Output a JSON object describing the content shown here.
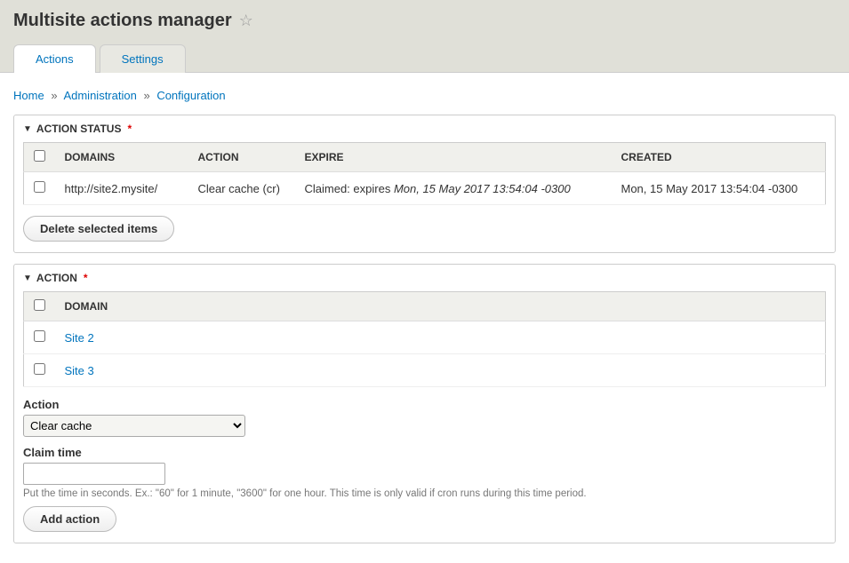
{
  "header": {
    "title": "Multisite actions manager"
  },
  "tabs": {
    "actions": "Actions",
    "settings": "Settings"
  },
  "breadcrumb": {
    "home": "Home",
    "administration": "Administration",
    "configuration": "Configuration"
  },
  "status_section": {
    "legend": "ACTION STATUS",
    "headers": {
      "domains": "DOMAINS",
      "action": "ACTION",
      "expire": "EXPIRE",
      "created": "CREATED"
    },
    "rows": [
      {
        "domain": "http://site2.mysite/",
        "action": "Clear cache (cr)",
        "expire_prefix": "Claimed: expires ",
        "expire_date": "Mon, 15 May 2017 13:54:04 -0300",
        "created": "Mon, 15 May 2017 13:54:04 -0300"
      }
    ],
    "delete_btn": "Delete selected items"
  },
  "action_section": {
    "legend": "ACTION",
    "domain_header": "DOMAIN",
    "domains": [
      {
        "label": "Site 2"
      },
      {
        "label": "Site 3"
      }
    ],
    "action_label": "Action",
    "action_value": "Clear cache",
    "claim_label": "Claim time",
    "claim_value": "",
    "claim_help": "Put the time in seconds. Ex.: \"60\" for 1 minute, \"3600\" for one hour. This time is only valid if cron runs during this time period.",
    "add_btn": "Add action"
  }
}
